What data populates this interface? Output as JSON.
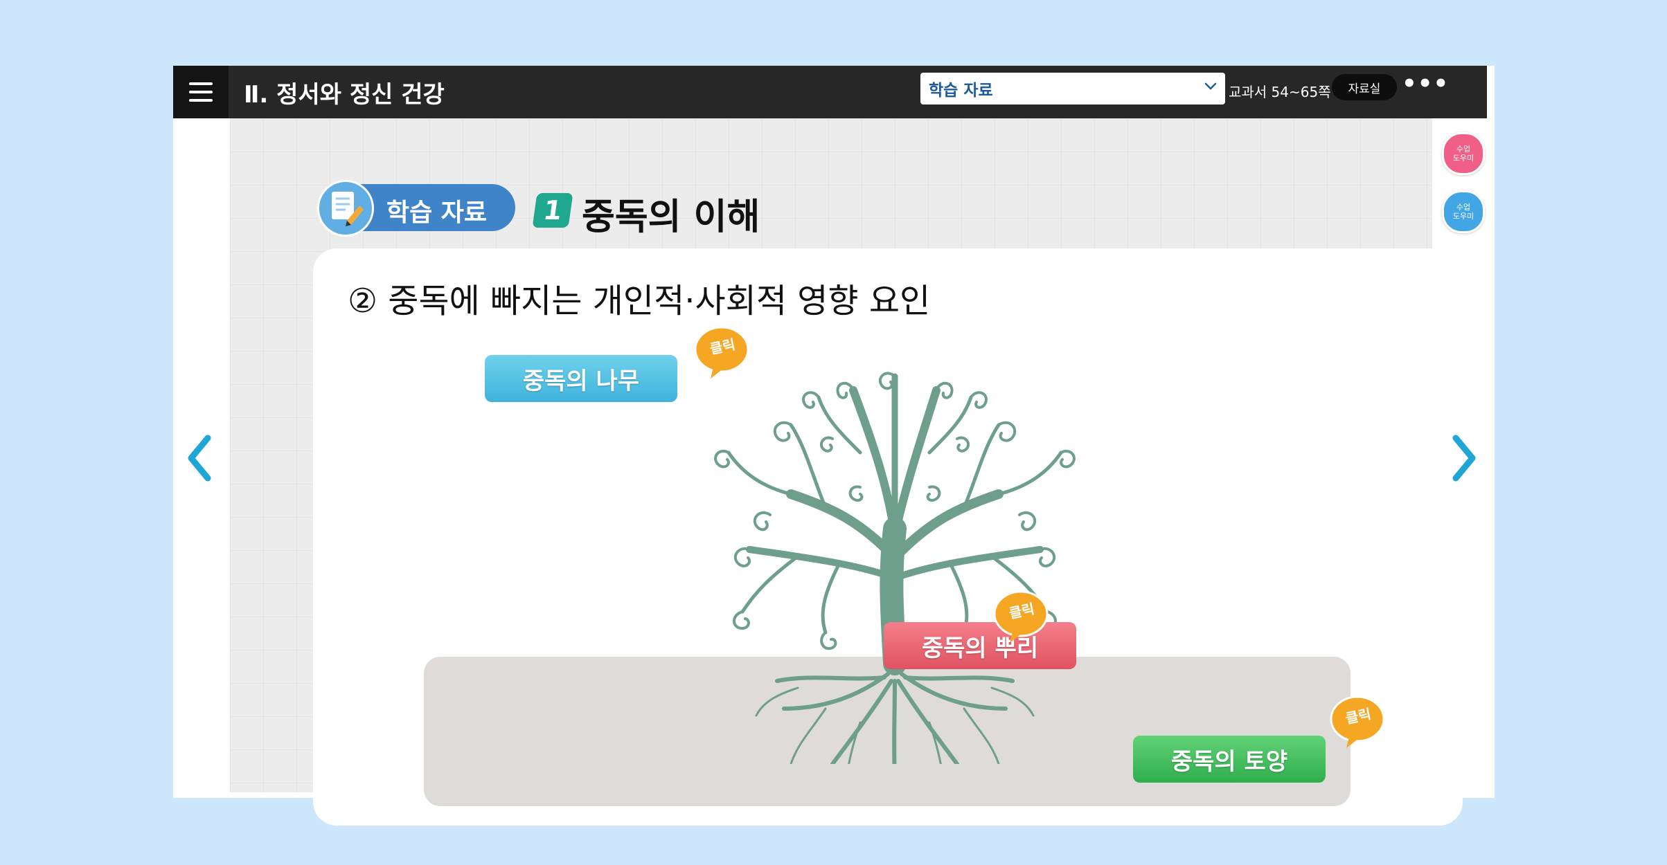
{
  "header": {
    "unit_title": "Ⅱ. 정서와 정신 건강",
    "selector_value": "학습 자료",
    "page_range": "교과서 54~65쪽",
    "library_label": "자료실",
    "more_label": "•••"
  },
  "section": {
    "badge_label": "학습 자료",
    "number": "1",
    "title": "중독의 이해"
  },
  "content": {
    "subtitle": "② 중독에 빠지는 개인적·사회적 영향 요인",
    "buttons": {
      "tree": "중독의 나무",
      "root": "중독의 뿌리",
      "soil": "중독의 토양"
    },
    "click_label": "클릭"
  },
  "side_tools": {
    "helper1": "수업\n도우미",
    "helper2": "수업\n도우미"
  },
  "colors": {
    "header_bg": "#272727",
    "accent_teal": "#1fa88d",
    "tree_green": "#6e9e8c",
    "tree_btn": "#3fb3dc",
    "root_btn": "#e05261",
    "soil_btn": "#2fae4c",
    "click_orange": "#f5a623",
    "nav_arrow": "#1fa6d6"
  }
}
